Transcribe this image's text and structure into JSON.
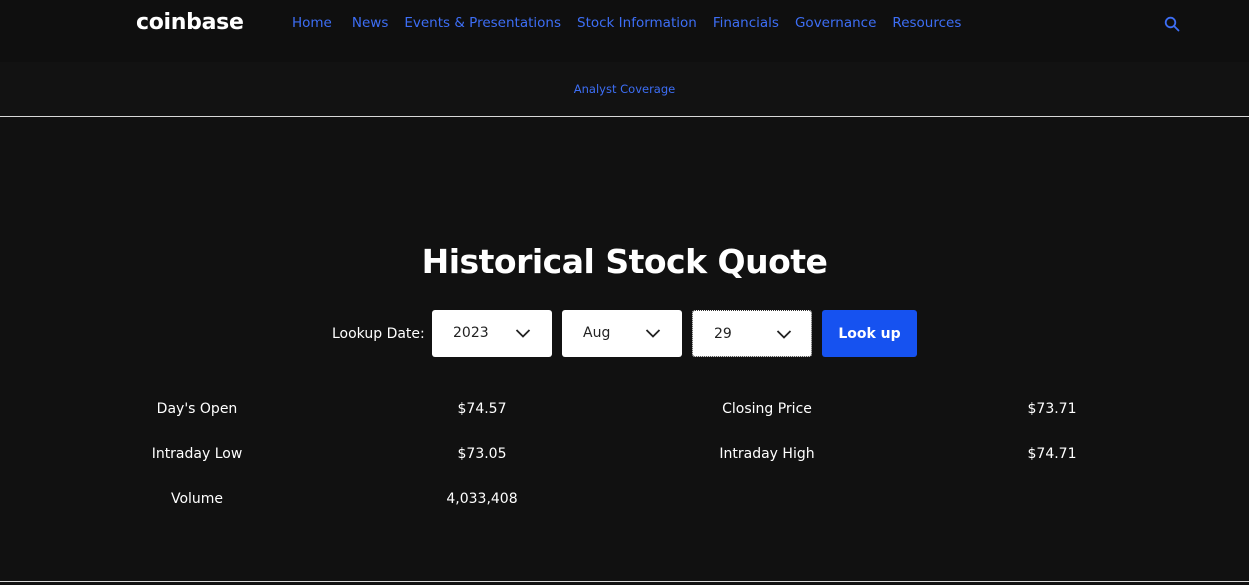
{
  "header": {
    "logo": "coinbase",
    "nav": [
      "Home",
      "News",
      "Events & Presentations",
      "Stock Information",
      "Financials",
      "Governance",
      "Resources"
    ],
    "search_icon": "search-icon"
  },
  "subnav": {
    "item": "Analyst Coverage"
  },
  "main": {
    "title": "Historical Stock Quote",
    "lookup_label": "Lookup Date:",
    "year": "2023",
    "month": "Aug",
    "day": "29",
    "lookup_button": "Look up"
  },
  "stats": {
    "days_open_label": "Day's Open",
    "days_open_value": "$74.57",
    "closing_price_label": "Closing Price",
    "closing_price_value": "$73.71",
    "intraday_low_label": "Intraday Low",
    "intraday_low_value": "$73.05",
    "intraday_high_label": "Intraday High",
    "intraday_high_value": "$74.71",
    "volume_label": "Volume",
    "volume_value": "4,033,408"
  },
  "colors": {
    "background": "#111111",
    "link": "#3d6ef5",
    "button": "#1652f0"
  }
}
